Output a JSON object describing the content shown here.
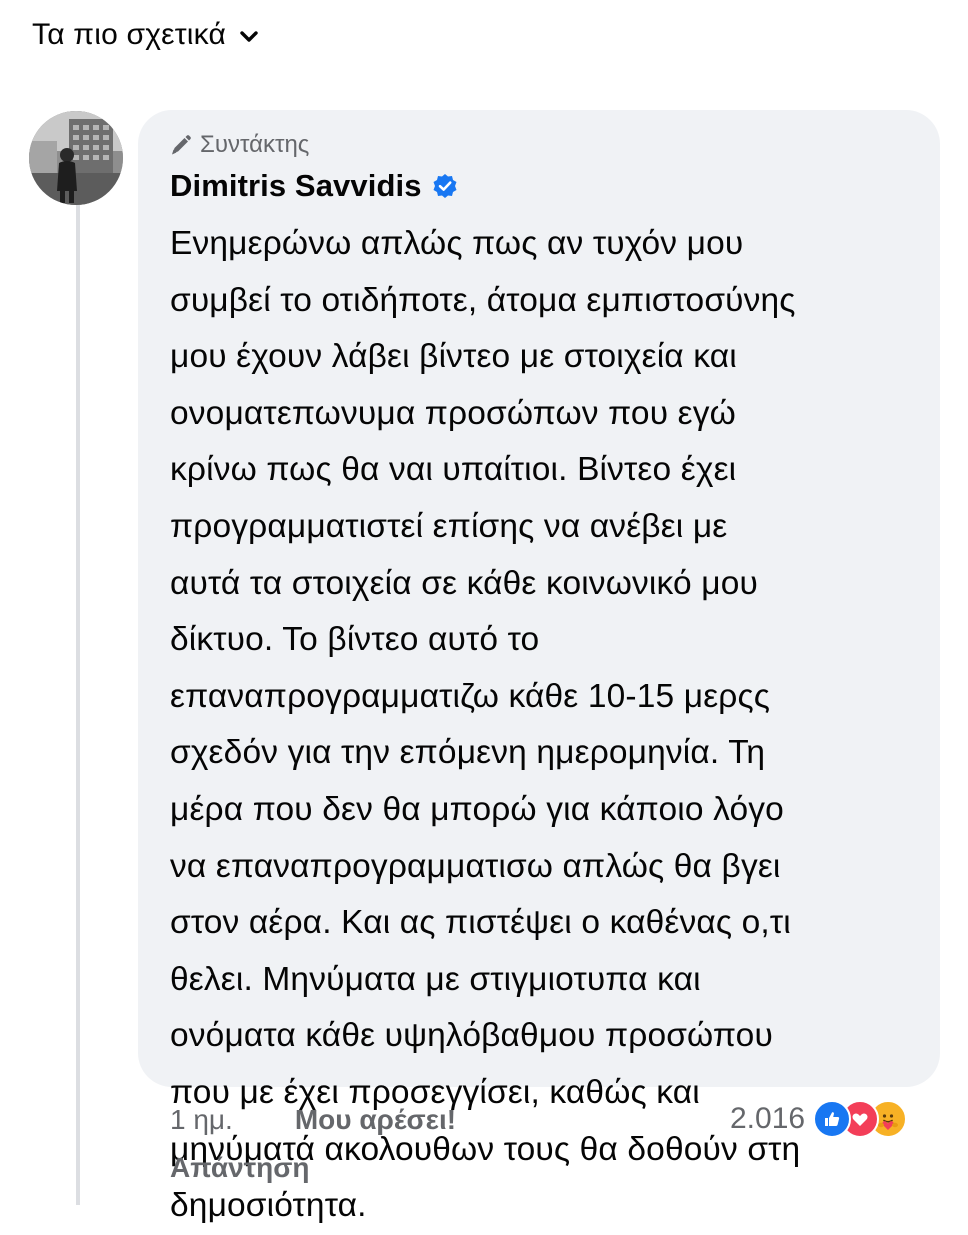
{
  "header": {
    "sort_label": "Τα πιο σχετικά",
    "sort_icon": "chevron-down-icon"
  },
  "comment": {
    "badge_icon": "pencil-icon",
    "badge_label": "Συντάκτης",
    "author": "Dimitris Savvidis",
    "verified_icon": "verified-badge-icon",
    "text": "Ενημερώνω απλώς πως αν τυχόν μου\nσυμβεί το οτιδήποτε, άτομα εμπιστοσύνης\nμου έχουν λάβει βίντεο με στοιχεία και\nονοματεπωνυμα προσώπων που εγώ\nκρίνω πως θα ναι υπαίτιοι.  Βίντεο έχει\nπρογραμματιστεί επίσης να ανέβει με\nαυτά τα στοιχεία σε κάθε κοινωνικό μου\nδίκτυο. Το βίντεο αυτό το\nεπαναπρογραμματιζω κάθε 10-15 μερςς\nσχεδόν για την επόμενη ημερομηνία. Τη\nμέρα που δεν θα μπορώ για κάποιο λόγο\nνα επαναπρογραμματισω απλώς θα βγει\nστον αέρα. Και ας πιστέψει ο καθένας ο,τι\nθελει. Μηνύματα με στιγμιοτυπα και\nονόματα κάθε υψηλόβαθμου προσώπου\nπου με έχει προσεγγίσει, καθώς και\nμηνύματά ακολουθων τους θα δοθούν στη\nδημοσιότητα.",
    "time": "1 ημ.",
    "like_label": "Μου αρέσει!",
    "reply_label": "Απάντηση",
    "reaction_count": "2.016",
    "reaction_icons": [
      "like-reaction-icon",
      "love-reaction-icon",
      "care-reaction-icon"
    ]
  },
  "colors": {
    "bubble_bg": "#f0f2f5",
    "secondary_text": "#65676b",
    "brand_blue": "#1877f2",
    "love_red": "#f33e58",
    "care_yellow": "#f7b125"
  }
}
